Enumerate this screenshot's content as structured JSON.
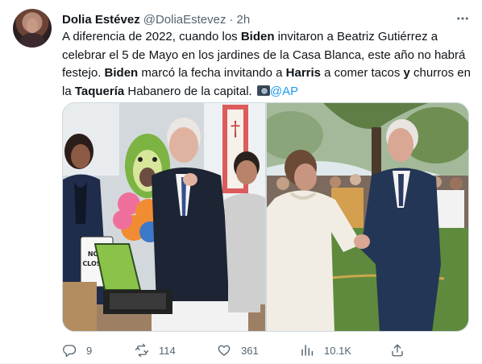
{
  "author": {
    "name": "Dolia Estévez",
    "handle": "@DoliaEstevez",
    "separator": "·",
    "time": "2h"
  },
  "tweet": {
    "t1": "A diferencia de 2022, cuando los ",
    "b1": "Biden",
    "t2": " invitaron a Beatriz Gutiérrez a celebrar el 5 de Mayo en los jardines de la Casa Blanca, este año no habrá festejo.  ",
    "b2": "Biden",
    "t3": " marcó la fecha invitando a ",
    "b3": "Harris",
    "t4": " a comer tacos ",
    "b4": "y",
    "t5": " churros en la ",
    "b5": "Taquería",
    "t6": " Habanero de la capital. ",
    "mention": "@AP"
  },
  "media": {
    "left_photo_alt": "Biden y Harris en la Taquería Habanero",
    "right_photo_alt": "Biden saluda a Beatriz Gutiérrez en la Casa Blanca",
    "sign_text": "NOW CLOSED"
  },
  "actions": {
    "replies": "9",
    "retweets": "114",
    "likes": "361",
    "views": "10.1K"
  },
  "icons": {
    "more": "more-horizontal-icon",
    "reply": "reply-icon",
    "retweet": "retweet-icon",
    "like": "heart-icon",
    "views": "views-icon",
    "share": "share-icon",
    "camera": "camera-emoji-icon"
  },
  "colors": {
    "link": "#1d9bf0",
    "muted": "#536471",
    "text": "#0f1419"
  }
}
